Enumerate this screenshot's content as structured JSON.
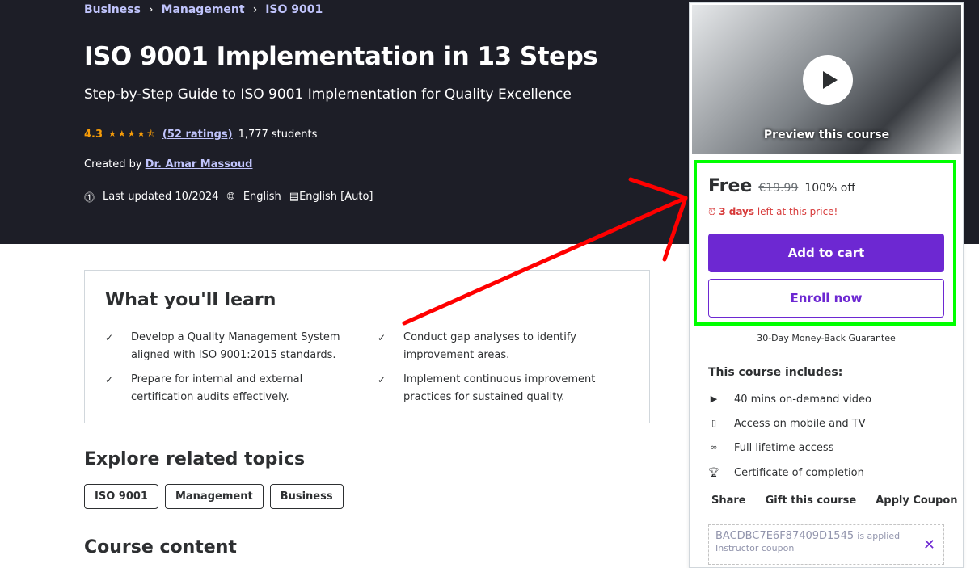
{
  "breadcrumb": [
    "Business",
    "Management",
    "ISO 9001"
  ],
  "title": "ISO 9001 Implementation in 13 Steps",
  "subtitle": "Step-by-Step Guide to ISO 9001 Implementation for Quality Excellence",
  "rating": {
    "value": "4.3",
    "stars": "★★★★⯪",
    "ratings": "(52 ratings)",
    "students": "1,777 students"
  },
  "created": {
    "label": "Created by",
    "author": "Dr. Amar Massoud"
  },
  "meta": {
    "updated": "Last updated 10/2024",
    "language": "English",
    "captions": "English [Auto]"
  },
  "learn": {
    "title": "What you'll learn",
    "items": [
      "Develop a Quality Management System aligned with ISO 9001:2015 standards.",
      "Conduct gap analyses to identify improvement areas.",
      "Prepare for internal and external certification audits effectively.",
      "Implement continuous improvement practices for sustained quality."
    ]
  },
  "related": {
    "title": "Explore related topics",
    "tags": [
      "ISO 9001",
      "Management",
      "Business"
    ]
  },
  "content_title": "Course content",
  "card": {
    "preview": "Preview this course",
    "price": "Free",
    "old_price": "€19.99",
    "discount": "100% off",
    "timer_bold": "3 days",
    "timer_rest": "left at this price!",
    "add_to_cart": "Add to cart",
    "enroll": "Enroll now",
    "guarantee": "30-Day Money-Back Guarantee",
    "includes_title": "This course includes:",
    "includes": [
      "40 mins on-demand video",
      "Access on mobile and TV",
      "Full lifetime access",
      "Certificate of completion"
    ],
    "actions": [
      "Share",
      "Gift this course",
      "Apply Coupon"
    ],
    "coupon_code": "BACDBC7E6F87409D1545",
    "coupon_status": "is applied",
    "coupon_type": "Instructor coupon"
  },
  "colors": {
    "accent": "#6d28d2",
    "highlight": "#00ff00",
    "arrow": "#ff0000"
  }
}
